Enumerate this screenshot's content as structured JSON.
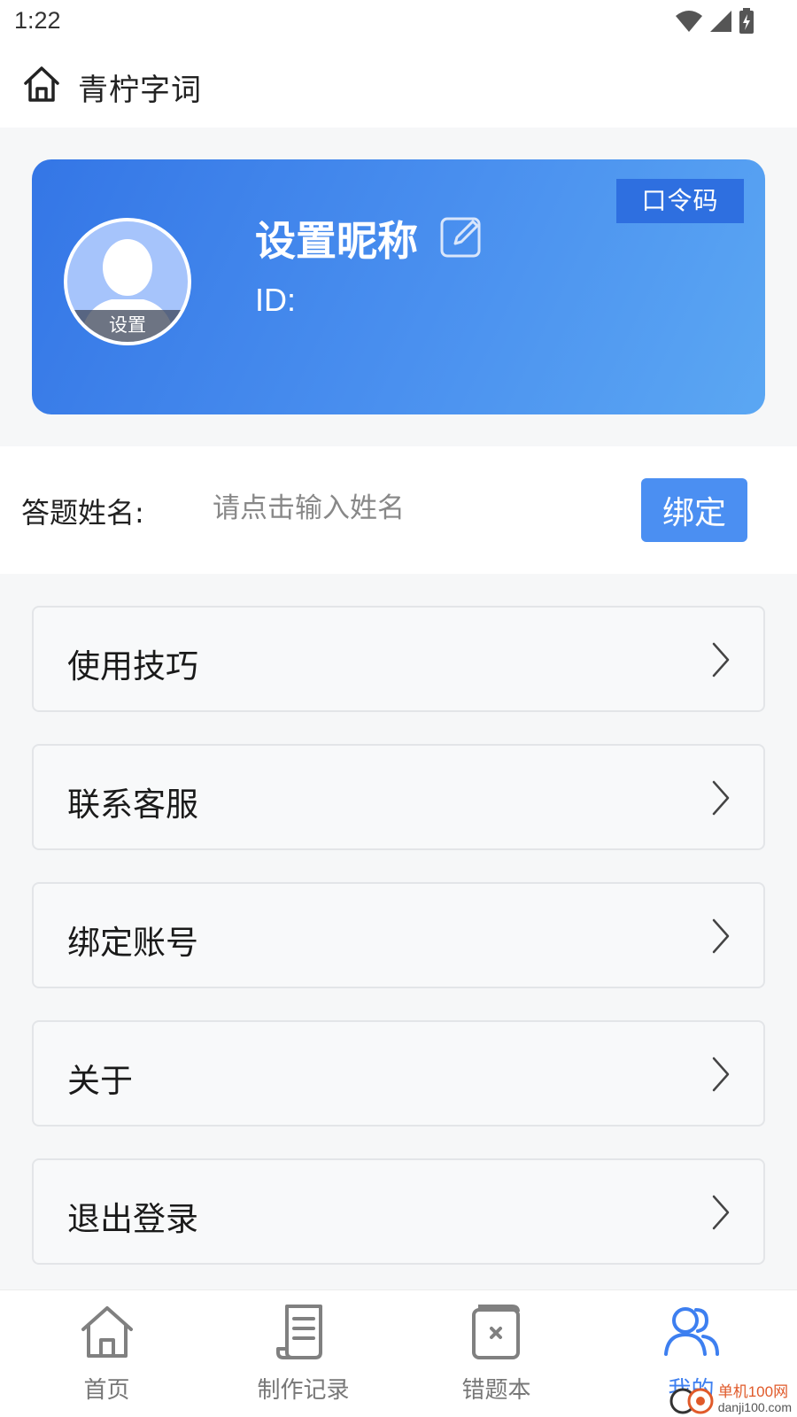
{
  "status_bar": {
    "time": "1:22",
    "icons": [
      "wifi-icon",
      "signal-icon",
      "battery-charging-icon"
    ]
  },
  "header": {
    "title": "青柠字词",
    "icon": "home-icon"
  },
  "profile": {
    "avatar_label": "设置",
    "nickname": "设置昵称",
    "id_label": "ID:",
    "code_button": "口令码",
    "card_colors": [
      "#3476e6",
      "#5ba7f3"
    ]
  },
  "bind": {
    "label": "答题姓名:",
    "placeholder": "请点击输入姓名",
    "value": "",
    "button": "绑定"
  },
  "menu": {
    "items": [
      {
        "label": "使用技巧"
      },
      {
        "label": "联系客服"
      },
      {
        "label": "绑定账号"
      },
      {
        "label": "关于"
      },
      {
        "label": "退出登录"
      }
    ]
  },
  "bottom_nav": {
    "active_color": "#3d7ff0",
    "items": [
      {
        "label": "首页",
        "icon": "home-icon"
      },
      {
        "label": "制作记录",
        "icon": "document-icon"
      },
      {
        "label": "错题本",
        "icon": "notebook-icon"
      },
      {
        "label": "我的",
        "icon": "users-icon",
        "active": true
      }
    ]
  },
  "watermark": {
    "line1": "单机100网",
    "line2": "danji100.com"
  }
}
